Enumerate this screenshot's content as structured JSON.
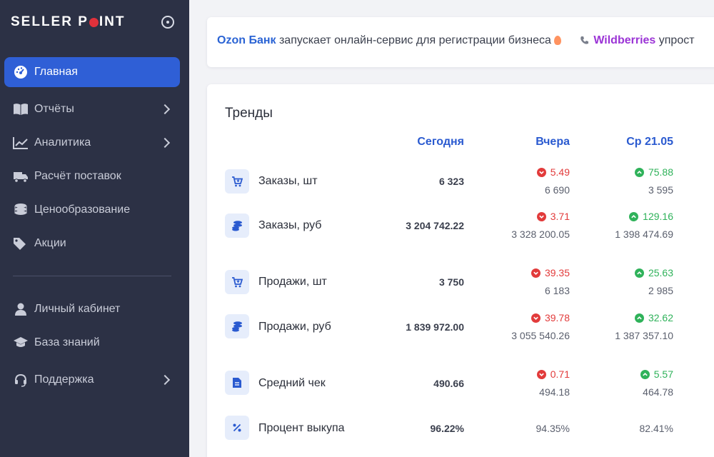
{
  "sidebar": {
    "logo_left": "SELLER P",
    "logo_right": "INT",
    "items": [
      {
        "label": "Главная",
        "icon": "dashboard-icon"
      },
      {
        "label": "Отчёты",
        "icon": "book-icon"
      },
      {
        "label": "Аналитика",
        "icon": "chart-line-icon"
      },
      {
        "label": "Расчёт поставок",
        "icon": "truck-icon"
      },
      {
        "label": "Ценообразование",
        "icon": "coins-icon"
      },
      {
        "label": "Акции",
        "icon": "tags-icon"
      },
      {
        "label": "Личный кабинет",
        "icon": "user-icon"
      },
      {
        "label": "База знаний",
        "icon": "graduation-cap-icon"
      },
      {
        "label": "Поддержка",
        "icon": "headset-icon"
      }
    ]
  },
  "ticker": {
    "brand1": "Ozon Банк",
    "text1": "запускает онлайн-сервис для регистрации бизнеса",
    "brand2": "Wildberries",
    "text2": "упрост"
  },
  "trends": {
    "title": "Тренды",
    "columns": [
      "Сегодня",
      "Вчера",
      "Ср 21.05"
    ],
    "rows": [
      {
        "label": "Заказы, шт",
        "icon": "cart-icon",
        "today": "6 323",
        "yesterday": {
          "dir": "down",
          "delta": "5.49",
          "prev": "6 690"
        },
        "wed": {
          "dir": "up",
          "delta": "75.88",
          "prev": "3 595"
        }
      },
      {
        "label": "Заказы, руб",
        "icon": "coins-icon",
        "today": "3 204 742.22",
        "yesterday": {
          "dir": "down",
          "delta": "3.71",
          "prev": "3 328 200.05"
        },
        "wed": {
          "dir": "up",
          "delta": "129.16",
          "prev": "1 398 474.69"
        }
      },
      {
        "label": "Продажи, шт",
        "icon": "cart-icon",
        "today": "3 750",
        "yesterday": {
          "dir": "down",
          "delta": "39.35",
          "prev": "6 183"
        },
        "wed": {
          "dir": "up",
          "delta": "25.63",
          "prev": "2 985"
        }
      },
      {
        "label": "Продажи, руб",
        "icon": "coins-icon",
        "today": "1 839 972.00",
        "yesterday": {
          "dir": "down",
          "delta": "39.78",
          "prev": "3 055 540.26"
        },
        "wed": {
          "dir": "up",
          "delta": "32.62",
          "prev": "1 387 357.10"
        }
      },
      {
        "label": "Средний чек",
        "icon": "receipt-icon",
        "today": "490.66",
        "yesterday": {
          "dir": "down",
          "delta": "0.71",
          "prev": "494.18"
        },
        "wed": {
          "dir": "up",
          "delta": "5.57",
          "prev": "464.78"
        }
      },
      {
        "label": "Процент выкупа",
        "icon": "percent-icon",
        "today": "96.22%",
        "yesterday_plain": "94.35%",
        "wed_plain": "82.41%"
      }
    ]
  },
  "colors": {
    "sidebar": "#2c3145",
    "accent": "#2f5fd6",
    "down": "#e23b3b",
    "up": "#2fb25a"
  }
}
